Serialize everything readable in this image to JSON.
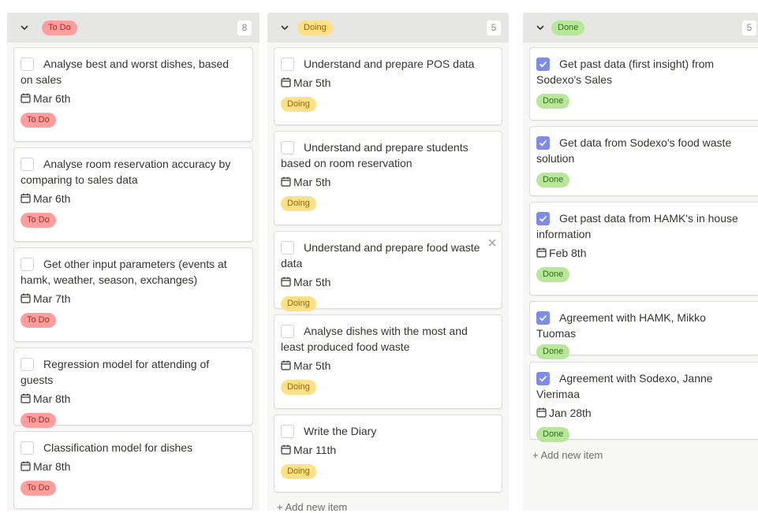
{
  "colors": {
    "todo": "#ff9e9e",
    "doing": "#fde087",
    "done": "#b8e79a",
    "checkbox": "#7d8ce8"
  },
  "columns": [
    {
      "tag": "To Do",
      "count": "8",
      "cards": [
        {
          "title": "Analyse best and worst dishes, based on sales",
          "date": "Mar 6th",
          "status": "To Do",
          "checked": false
        },
        {
          "title": "Analyse room reservation accuracy by comparing to sales data",
          "date": "Mar 6th",
          "status": "To Do",
          "checked": false
        },
        {
          "title": "Get other input parameters (events at hamk, weather, season, exchanges)",
          "date": "Mar 7th",
          "status": "To Do",
          "checked": false
        },
        {
          "title": "Regression model for attending of guests",
          "date": "Mar 8th",
          "status": "To Do",
          "checked": false
        },
        {
          "title": "Classification model for dishes",
          "date": "Mar 8th",
          "status": "To Do",
          "checked": false
        }
      ]
    },
    {
      "tag": "Doing",
      "count": "5",
      "cards": [
        {
          "title": "Understand and prepare POS data",
          "date": "Mar 5th",
          "status": "Doing",
          "checked": false
        },
        {
          "title": "Understand and prepare students based on room reservation",
          "date": "Mar 5th",
          "status": "Doing",
          "checked": false
        },
        {
          "title": "Understand and prepare food waste data",
          "date": "Mar 5th",
          "status": "Doing",
          "checked": false,
          "close_icon": "close-icon"
        },
        {
          "title": "Analyse dishes with the most and least produced food waste",
          "date": "Mar 5th",
          "status": "Doing",
          "checked": false
        },
        {
          "title": "Write the Diary",
          "date": "Mar 11th",
          "status": "Doing",
          "checked": false
        }
      ],
      "add_item": "+ Add new item"
    },
    {
      "tag": "Done",
      "count": "5",
      "cards": [
        {
          "title": "Get past data (first insight) from Sodexo's Sales",
          "date": "",
          "status": "Done",
          "checked": true
        },
        {
          "title": "Get data from Sodexo's food waste solution",
          "date": "",
          "status": "Done",
          "checked": true
        },
        {
          "title": "Get past data from HAMK's in house information",
          "date": "Feb 8th",
          "status": "Done",
          "checked": true
        },
        {
          "title": "Agreement with HAMK, Mikko Tuomas",
          "date": "",
          "status": "Done",
          "checked": true
        },
        {
          "title": "Agreement with Sodexo, Janne Vierimaa",
          "date": "Jan 28th",
          "status": "Done",
          "checked": true
        }
      ],
      "add_item": "+ Add new item"
    }
  ]
}
